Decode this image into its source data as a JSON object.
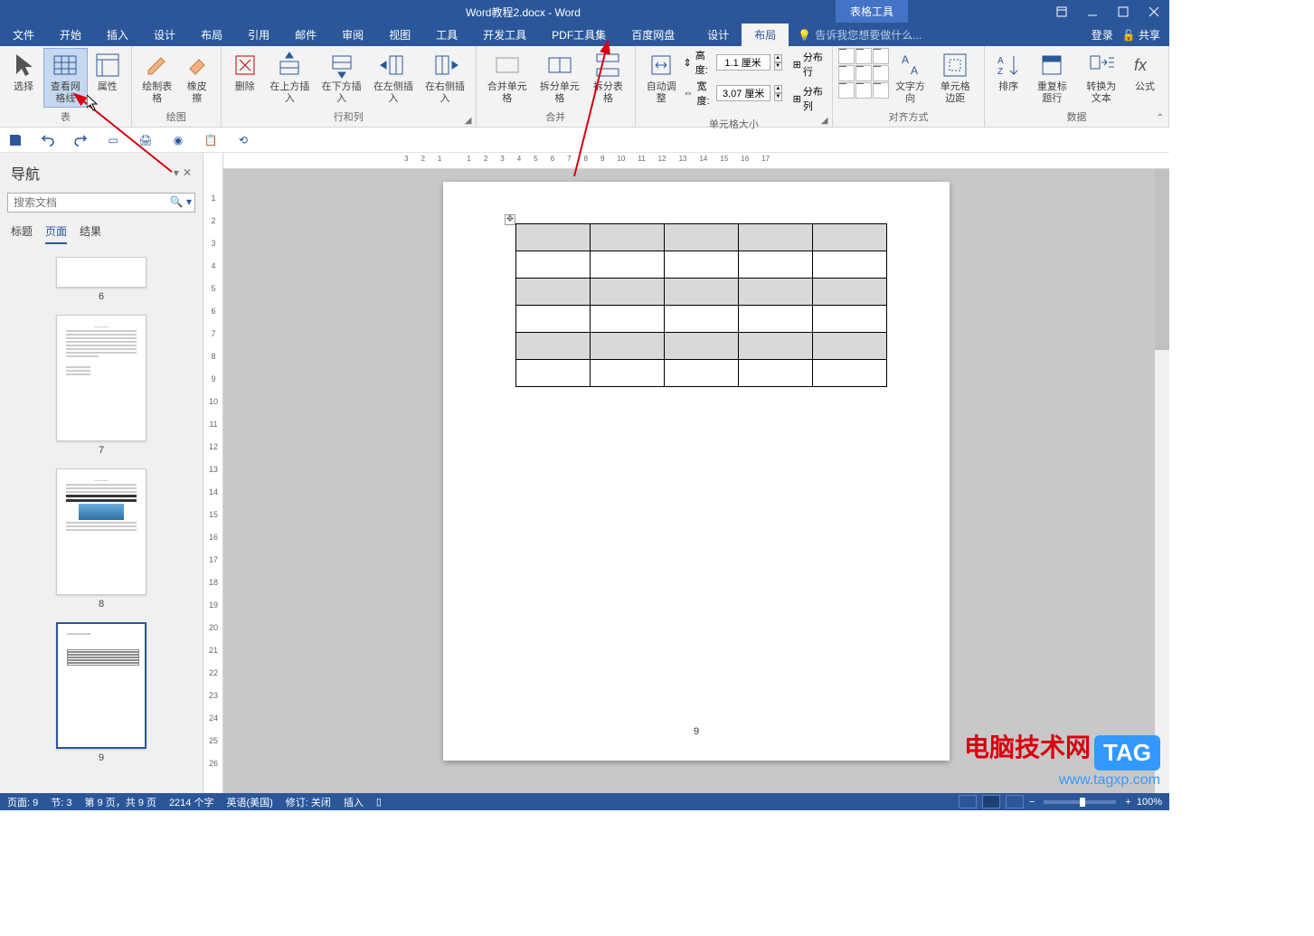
{
  "window": {
    "title": "Word教程2.docx - Word",
    "table_tools": "表格工具",
    "controls": [
      "restore",
      "minimize",
      "maximize",
      "close"
    ]
  },
  "tabs": {
    "items": [
      "文件",
      "开始",
      "插入",
      "设计",
      "布局",
      "引用",
      "邮件",
      "审阅",
      "视图",
      "工具",
      "开发工具",
      "PDF工具集",
      "百度网盘"
    ],
    "tools_items": [
      "设计",
      "布局"
    ],
    "active_tool": 1,
    "tell_me": "告诉我您想要做什么...",
    "login": "登录",
    "share": "共享"
  },
  "ribbon": {
    "groups": {
      "table": {
        "label": "表",
        "select": "选择",
        "view_grid": "查看网格线",
        "props": "属性"
      },
      "draw": {
        "label": "绘图",
        "draw": "绘制表格",
        "eraser": "橡皮擦"
      },
      "rowcol": {
        "label": "行和列",
        "delete": "删除",
        "ins_above": "在上方插入",
        "ins_below": "在下方插入",
        "ins_left": "在左侧插入",
        "ins_right": "在右侧插入"
      },
      "merge": {
        "label": "合并",
        "merge_cells": "合并单元格",
        "split_cells": "拆分单元格",
        "split_table": "拆分表格"
      },
      "autofit": {
        "label": "",
        "autofit": "自动调整"
      },
      "cellsize": {
        "label": "单元格大小",
        "height": "高度:",
        "width": "宽度:",
        "h_val": "1.1 厘米",
        "w_val": "3.07 厘米",
        "dist_rows": "分布行",
        "dist_cols": "分布列"
      },
      "align": {
        "label": "对齐方式",
        "text_dir": "文字方向",
        "cell_margin": "单元格边距"
      },
      "data": {
        "label": "数据",
        "sort": "排序",
        "repeat_header": "重复标题行",
        "to_text": "转换为文本",
        "formula": "公式"
      }
    }
  },
  "navpane": {
    "title": "导航",
    "search_placeholder": "搜索文档",
    "tabs": [
      "标题",
      "页面",
      "结果"
    ],
    "active_tab": 1,
    "pages": [
      "6",
      "7",
      "8",
      "9"
    ],
    "selected": 3
  },
  "document": {
    "page_number": "9"
  },
  "statusbar": {
    "page": "页面: 9",
    "section": "节: 3",
    "page_of": "第 9 页，共 9 页",
    "words": "2214 个字",
    "lang": "英语(美国)",
    "track": "修订: 关闭",
    "insert": "插入",
    "zoom": "100%"
  },
  "watermark": {
    "site": "电脑技术网",
    "tag": "TAG",
    "url": "www.tagxp.com"
  }
}
